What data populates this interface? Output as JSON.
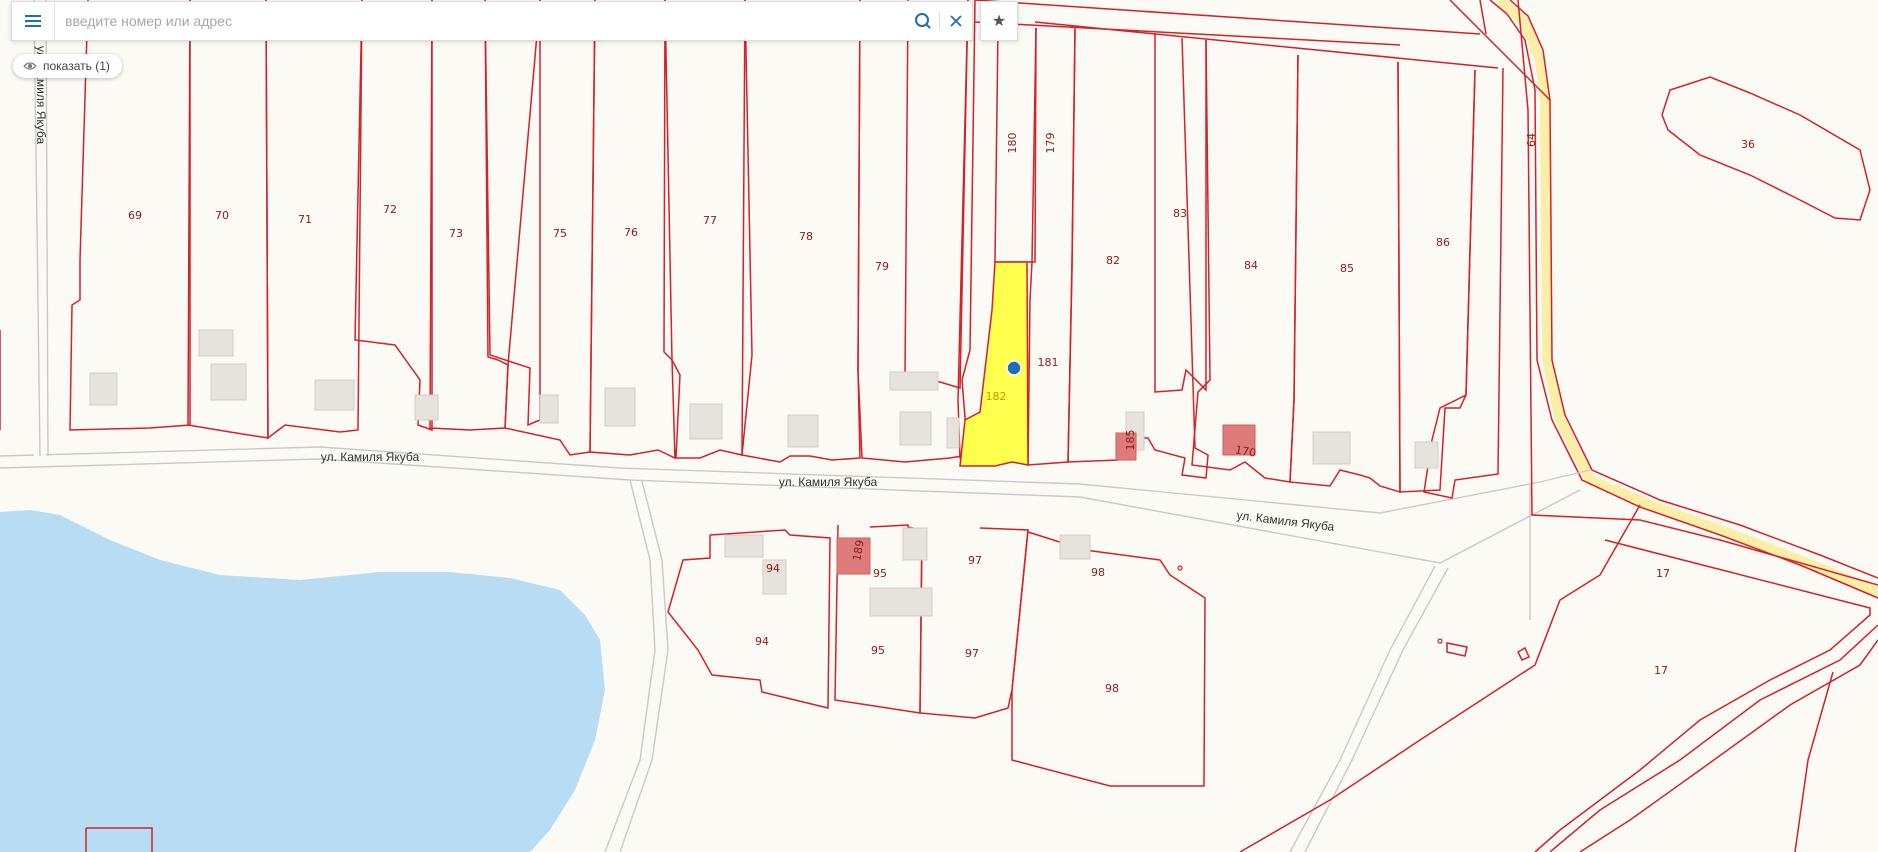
{
  "search": {
    "placeholder": "введите номер или адрес"
  },
  "chip": {
    "show_label": "показать (1)"
  },
  "map": {
    "street_names": [
      "ул. Камиля Якуба",
      "ул. Камиля Якуба",
      "ул. Камиля Якуба",
      "ул. Камиля Якуба"
    ],
    "parcel_labels": {
      "p69": "69",
      "p70": "70",
      "p71": "71",
      "p72": "72",
      "p73": "73",
      "p75": "75",
      "p76": "76",
      "p77": "77",
      "p78": "78",
      "p79": "79",
      "p180": "180",
      "p179": "179",
      "p181": "181",
      "p182": "182",
      "p82": "82",
      "p83": "83",
      "p84": "84",
      "p85": "85",
      "p86": "86",
      "p64": "64",
      "p36": "36",
      "p94a": "94",
      "p94b": "94",
      "p95a": "95",
      "p95b": "95",
      "p97a": "97",
      "p97b": "97",
      "p98a": "98",
      "p98b": "98",
      "p17a": "17",
      "p17b": "17",
      "b185": "185",
      "b170": "170",
      "b189": "189"
    },
    "colors": {
      "parcel_border": "#d4212a",
      "selected_parcel": "#ffff4d",
      "water": "#b7dcf4",
      "highlight_road": "#fbefa8",
      "marker": "#1b6fb8"
    }
  }
}
